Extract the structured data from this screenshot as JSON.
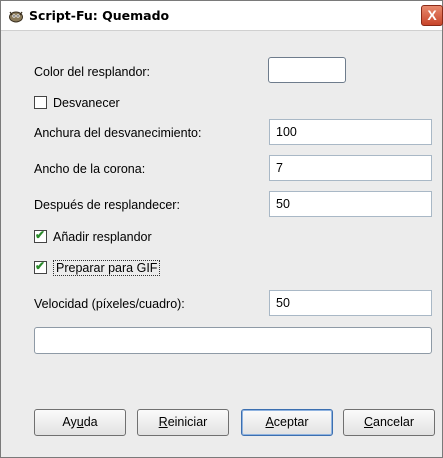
{
  "window": {
    "title": "Script-Fu: Quemado",
    "close_glyph": "X",
    "icon": "gimp-wilber-icon"
  },
  "form": {
    "glow_color_label": "Color del resplandor:",
    "fade_away_label": "Desvanecer",
    "fade_away_checked": false,
    "fade_width_label": "Anchura del desvanecimiento:",
    "fade_width_value": "100",
    "corona_width_label": "Ancho de la corona:",
    "corona_width_value": "7",
    "after_glow_label": "Después de resplandecer:",
    "after_glow_value": "50",
    "add_glow_label": "Añadir resplandor",
    "add_glow_checked": true,
    "prepare_gif_label": "Preparar para GIF",
    "prepare_gif_checked": true,
    "speed_label": "Velocidad (píxeles/cuadro):",
    "speed_value": "50",
    "progress_text": ""
  },
  "buttons": {
    "help_pre": "Ay",
    "help_mnemonic": "u",
    "help_post": "da",
    "reset_pre": "",
    "reset_mnemonic": "R",
    "reset_post": "einiciar",
    "ok_pre": "",
    "ok_mnemonic": "A",
    "ok_post": "ceptar",
    "cancel_pre": "",
    "cancel_mnemonic": "C",
    "cancel_post": "ancelar"
  },
  "colors": {
    "check_mark": "#2a8a2a",
    "close_button": "#c8452b"
  }
}
